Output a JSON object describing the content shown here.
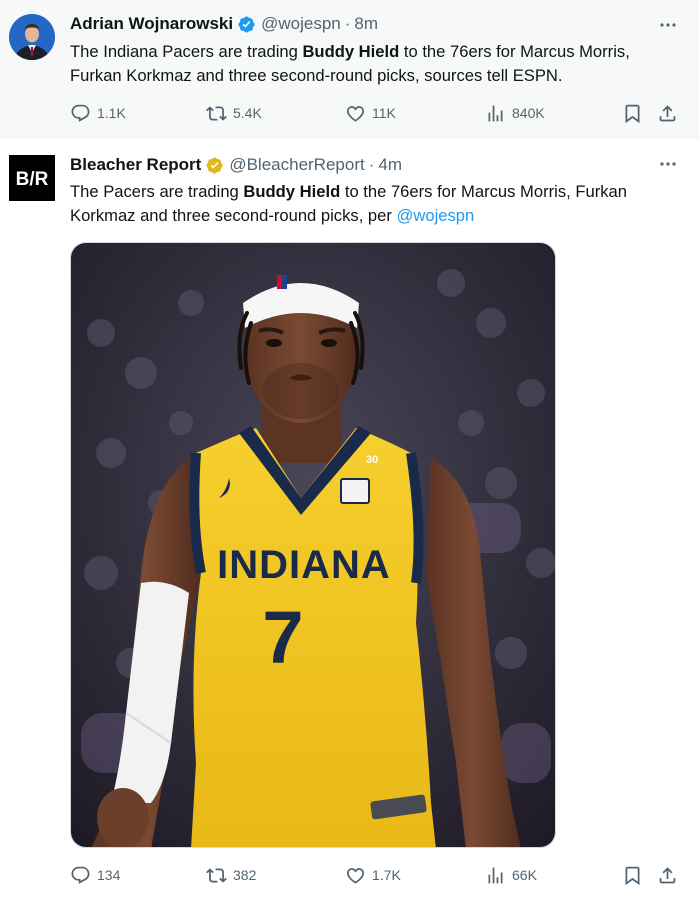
{
  "tweets": [
    {
      "name": "Adrian Wojnarowski",
      "handle": "@wojespn",
      "separator": "·",
      "time": "8m",
      "text_parts": {
        "before": "The Indiana Pacers are trading ",
        "bold": "Buddy Hield",
        "after": " to the 76ers for Marcus Morris, Furkan Korkmaz and three second-round picks, sources tell ESPN."
      },
      "stats": {
        "replies": "1.1K",
        "reposts": "5.4K",
        "likes": "11K",
        "views": "840K"
      },
      "badge_color": "#1d9bf0"
    },
    {
      "name": "Bleacher Report",
      "handle": "@BleacherReport",
      "separator": "·",
      "time": "4m",
      "avatar_text": "B/R",
      "text_parts": {
        "before": "The Pacers are trading ",
        "bold": "Buddy Hield",
        "after": " to the 76ers for Marcus Morris, Furkan Korkmaz and three second-round picks, per ",
        "mention": "@wojespn"
      },
      "media": {
        "jersey_text": "INDIANA",
        "jersey_number": "7",
        "shoulder_number": "30"
      },
      "stats": {
        "replies": "134",
        "reposts": "382",
        "likes": "1.7K",
        "views": "66K"
      },
      "badge_color": "#e2b719"
    }
  ],
  "icons": {
    "reply": "reply-icon",
    "repost": "repost-icon",
    "like": "heart-icon",
    "views": "views-icon",
    "bookmark": "bookmark-icon",
    "share": "share-icon",
    "more": "more-icon"
  }
}
